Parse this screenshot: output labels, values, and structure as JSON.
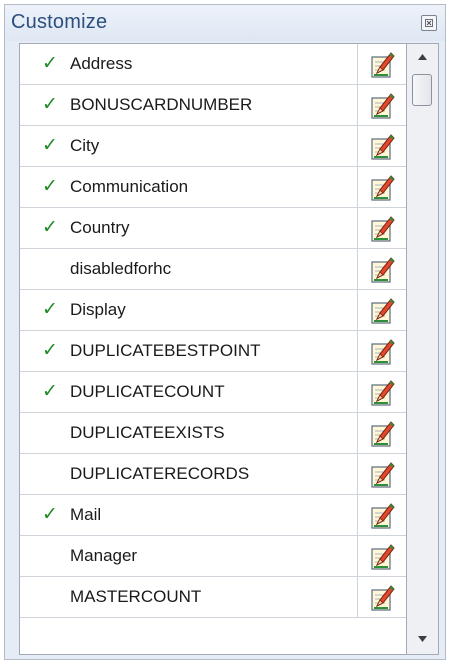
{
  "panel": {
    "title": "Customize",
    "close_icon": "close-icon"
  },
  "fields": [
    {
      "label": "Address",
      "checked": true
    },
    {
      "label": "BONUSCARDNUMBER",
      "checked": true
    },
    {
      "label": "City",
      "checked": true
    },
    {
      "label": "Communication",
      "checked": true
    },
    {
      "label": "Country",
      "checked": true
    },
    {
      "label": "disabledforhc",
      "checked": false
    },
    {
      "label": "Display",
      "checked": true
    },
    {
      "label": "DUPLICATEBESTPOINT",
      "checked": true
    },
    {
      "label": "DUPLICATECOUNT",
      "checked": true
    },
    {
      "label": "DUPLICATEEXISTS",
      "checked": false
    },
    {
      "label": "DUPLICATERECORDS",
      "checked": false
    },
    {
      "label": "Mail",
      "checked": true
    },
    {
      "label": "Manager",
      "checked": false
    },
    {
      "label": "MASTERCOUNT",
      "checked": false
    }
  ],
  "icons": {
    "check": "checkmark-icon",
    "edit": "edit-icon",
    "scroll_up": "scroll-up-arrow-icon",
    "scroll_down": "scroll-down-arrow-icon"
  },
  "colors": {
    "title_text": "#2b4f7f",
    "check_green": "#1f8a24",
    "panel_bg": "#e6ecf6"
  },
  "check_glyph": "✓"
}
